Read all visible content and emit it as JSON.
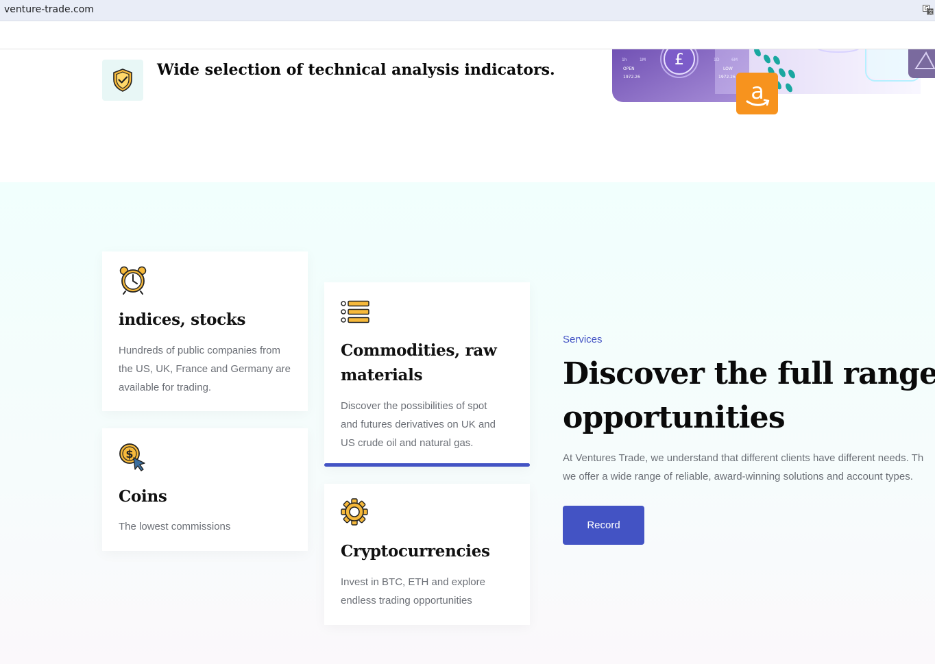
{
  "browser": {
    "url": "venture-trade.com"
  },
  "feature": {
    "text": "Wide selection of technical analysis indicators."
  },
  "hero": {
    "panel": {
      "tf_1h": "1h",
      "tf_1m": "1M",
      "tf_1d": "1D",
      "tf_6m": "6M",
      "open_label": "OPEN",
      "open_value": "1972.26",
      "low_label": "LOW",
      "low_value": "1972.26",
      "currency_symbol": "£"
    },
    "amazon_letter": "a"
  },
  "services": {
    "label": "Services",
    "title_line1": "Discover the full range of",
    "title_line2": "opportunities",
    "desc_line1": "At Ventures Trade, we understand that different clients have different needs. Th",
    "desc_line2": "we offer a wide range of reliable, award-winning solutions and account types.",
    "button_label": "Record",
    "cards": [
      {
        "icon": "alarm-clock-icon",
        "title": "indices, stocks",
        "desc_lines": [
          "Hundreds of public companies from",
          "the US, UK, France and Germany are",
          "available for trading."
        ]
      },
      {
        "icon": "coin-cursor-icon",
        "title": "Coins",
        "desc_lines": [
          "The lowest commissions"
        ]
      },
      {
        "icon": "list-icon",
        "title_lines": [
          "Commodities, raw",
          "materials"
        ],
        "desc_lines": [
          "Discover the possibilities of spot",
          "and futures derivatives on UK and",
          "US crude oil and natural gas."
        ]
      },
      {
        "icon": "gear-icon",
        "title": "Cryptocurrencies",
        "desc_lines": [
          "Invest in BTC, ETH and explore",
          "endless trading opportunities"
        ]
      }
    ]
  },
  "colors": {
    "accent": "#4353c4",
    "icon_yellow": "#f6b93b",
    "amazon_orange": "#f7931e",
    "teal": "#19a7a0"
  }
}
